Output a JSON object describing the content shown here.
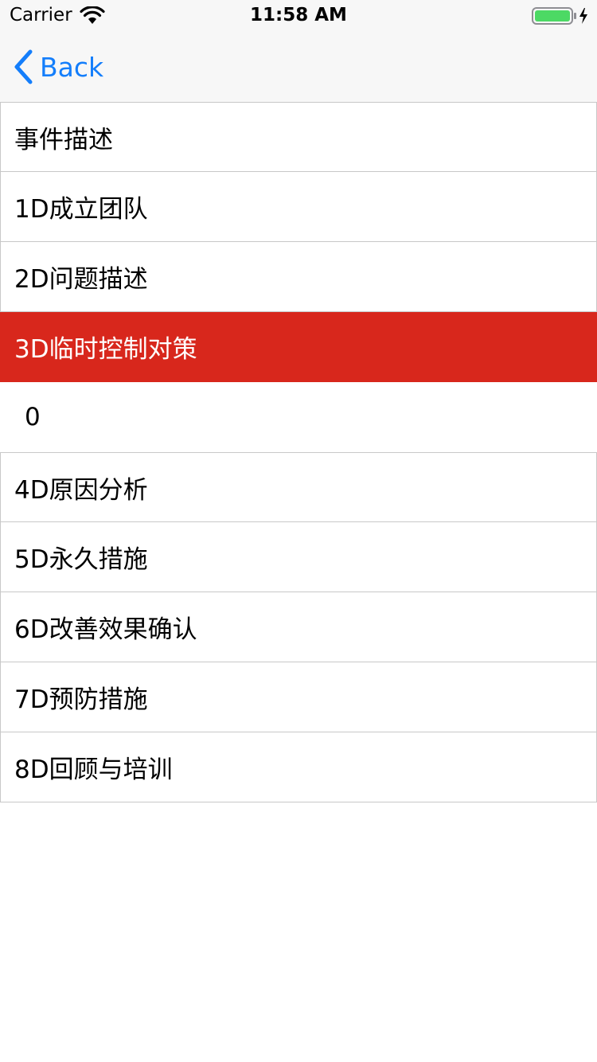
{
  "status_bar": {
    "carrier": "Carrier",
    "time": "11:58 AM",
    "battery_color": "#4cd964"
  },
  "nav": {
    "back_label": "Back",
    "accent_color": "#147efb"
  },
  "items": [
    {
      "label": "事件描述"
    },
    {
      "label": "1D成立团队"
    },
    {
      "label": "2D问题描述"
    },
    {
      "label": "3D临时控制对策",
      "selected": true,
      "highlight_color": "#d8271c"
    },
    {
      "label": "0",
      "is_detail": true
    },
    {
      "label": "4D原因分析"
    },
    {
      "label": "5D永久措施"
    },
    {
      "label": "6D改善效果确认"
    },
    {
      "label": "7D预防措施"
    },
    {
      "label": "8D回顾与培训"
    }
  ]
}
